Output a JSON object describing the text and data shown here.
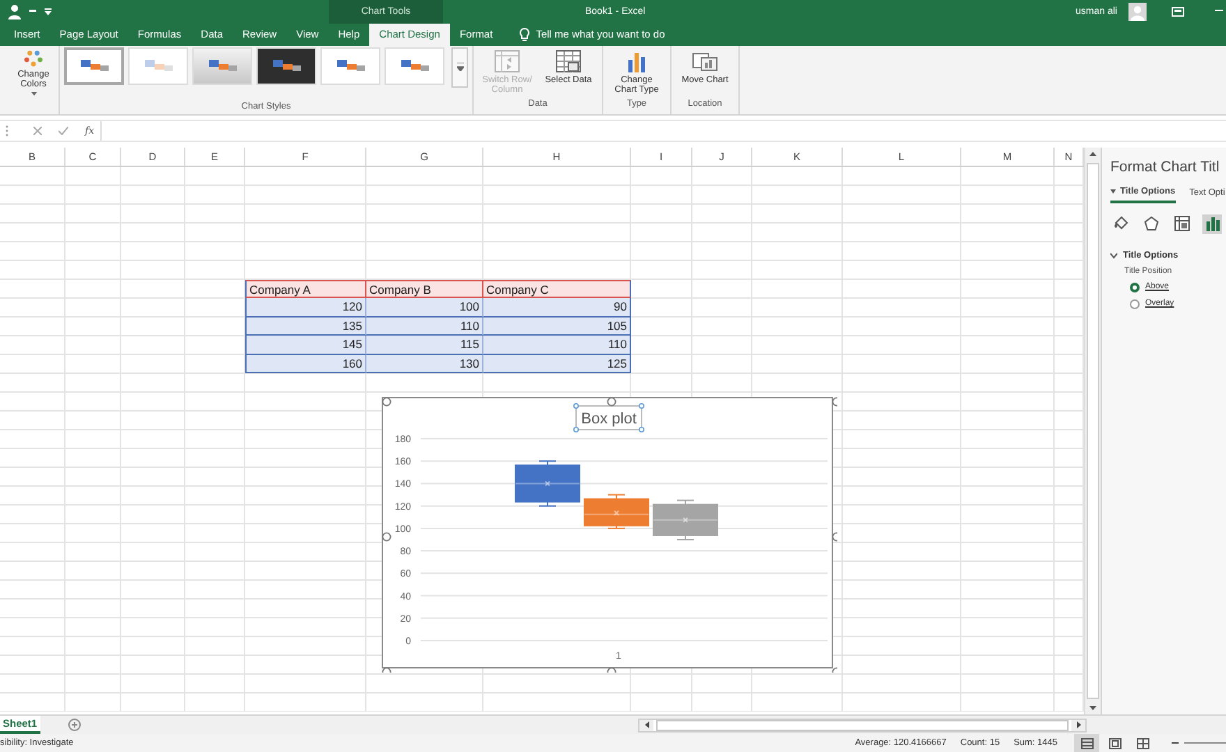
{
  "window": {
    "title": "Book1 - Excel",
    "context_group": "Chart Tools",
    "user": "usman ali"
  },
  "ribbon_tabs": [
    {
      "label": "Insert",
      "selected": false
    },
    {
      "label": "Page Layout",
      "selected": false
    },
    {
      "label": "Formulas",
      "selected": false
    },
    {
      "label": "Data",
      "selected": false
    },
    {
      "label": "Review",
      "selected": false
    },
    {
      "label": "View",
      "selected": false
    },
    {
      "label": "Help",
      "selected": false
    },
    {
      "label": "Chart Design",
      "selected": true
    },
    {
      "label": "Format",
      "selected": false
    }
  ],
  "tell_me": "Tell me what you want to do",
  "ribbon": {
    "change_colors": "Change Colors",
    "chart_styles": {
      "label": "Chart Styles",
      "styles": [
        {
          "kind": "plain",
          "selected": true
        },
        {
          "kind": "faint",
          "selected": false
        },
        {
          "kind": "shaded",
          "selected": false
        },
        {
          "kind": "dark",
          "selected": false
        },
        {
          "kind": "plain",
          "selected": false
        },
        {
          "kind": "plain",
          "selected": false
        }
      ]
    },
    "groups": [
      {
        "label": "Data",
        "buttons": [
          {
            "kind": "switch",
            "label": "Switch Row/ Column",
            "disabled": true
          },
          {
            "kind": "select",
            "label": "Select Data",
            "disabled": false
          }
        ]
      },
      {
        "label": "Type",
        "buttons": [
          {
            "kind": "chart-type",
            "label": "Change Chart Type",
            "disabled": false
          }
        ]
      },
      {
        "label": "Location",
        "buttons": [
          {
            "kind": "move",
            "label": "Move Chart",
            "disabled": false
          }
        ]
      }
    ]
  },
  "formula_bar": {
    "function_label": "fx"
  },
  "columns": [
    "B",
    "C",
    "D",
    "E",
    "F",
    "G",
    "H",
    "I",
    "J",
    "K",
    "L",
    "M",
    "N"
  ],
  "table": {
    "columns": [
      "Company A",
      "Company B",
      "Company C"
    ],
    "rows": [
      [
        "120",
        "100",
        "90"
      ],
      [
        "135",
        "110",
        "105"
      ],
      [
        "145",
        "115",
        "110"
      ],
      [
        "160",
        "130",
        "125"
      ]
    ]
  },
  "chart": {
    "title": "Box plot",
    "category": "1",
    "yticks": [
      "180",
      "160",
      "140",
      "120",
      "100",
      "80",
      "60",
      "40",
      "20",
      "0"
    ],
    "series": [
      {
        "color": "#4472c4"
      },
      {
        "color": "#ed7d31"
      },
      {
        "color": "#a5a5a5"
      }
    ]
  },
  "format_pane": {
    "title": "Format Chart Titl",
    "tabs": [
      {
        "label": "Title Options",
        "selected": true
      },
      {
        "label": "Text Opti",
        "selected": false
      }
    ],
    "icons": [
      {
        "kind": "fill",
        "selected": false
      },
      {
        "kind": "effects",
        "selected": false
      },
      {
        "kind": "size",
        "selected": false
      },
      {
        "kind": "chart",
        "selected": true
      }
    ],
    "section": {
      "title": "Title Options",
      "expanded": true,
      "field_label": "Title Position",
      "options": [
        {
          "label": "Above",
          "selected": true
        },
        {
          "label": "Overlay",
          "selected": false
        }
      ]
    }
  },
  "sheet_tabs": [
    {
      "label": "Sheet1",
      "selected": true
    }
  ],
  "status_bar": {
    "accessibility": "sibility: Investigate",
    "average": "Average: 120.4166667",
    "count": "Count: 15",
    "sum": "Sum: 1445",
    "views": [
      {
        "kind": "normal",
        "selected": true
      },
      {
        "kind": "page-layout",
        "selected": false
      },
      {
        "kind": "page-break",
        "selected": false
      }
    ]
  }
}
